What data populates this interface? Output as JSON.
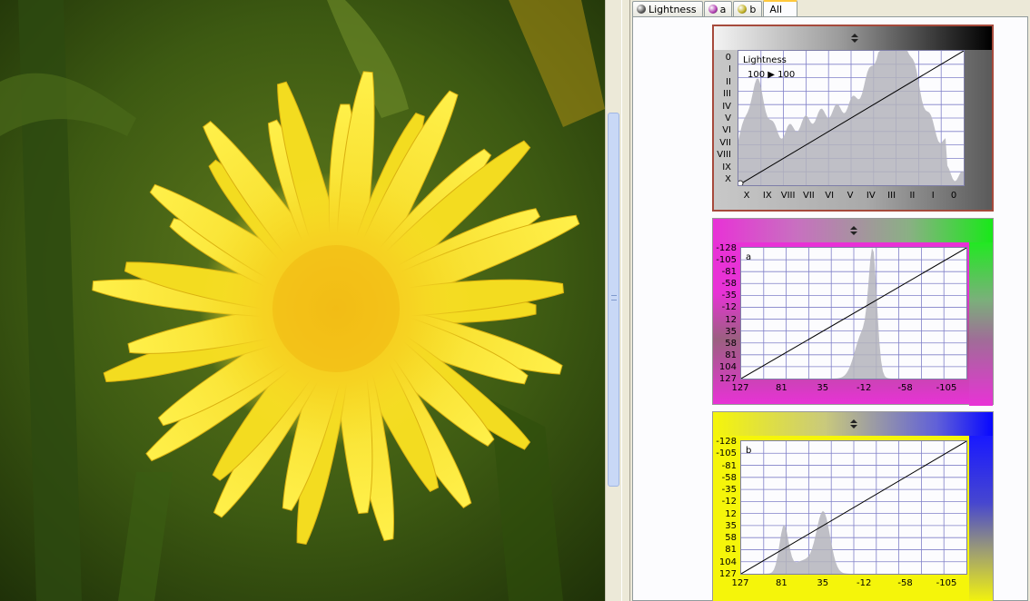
{
  "tabs": [
    {
      "label": "Lightness",
      "icon": "lightness-ball-icon",
      "color": "#555555"
    },
    {
      "label": "a",
      "icon": "a-ball-icon",
      "color": "#b03cb0"
    },
    {
      "label": "b",
      "icon": "b-ball-icon",
      "color": "#c0b020"
    },
    {
      "label": "All",
      "active": true
    }
  ],
  "lightness": {
    "name": "Lightness",
    "range": "100 ▶ 100",
    "y_ticks": [
      "0",
      "I",
      "II",
      "III",
      "IV",
      "V",
      "VI",
      "VII",
      "VIII",
      "IX",
      "X"
    ],
    "x_ticks": [
      "X",
      "IX",
      "VIII",
      "VII",
      "VI",
      "V",
      "IV",
      "III",
      "II",
      "I",
      "0"
    ],
    "colors": {
      "frame": "#a64a3c",
      "grid": "#8080c8",
      "hist": "#a9a9a9"
    }
  },
  "a_channel": {
    "name": "a",
    "y_ticks": [
      "-128",
      "-105",
      "-81",
      "-58",
      "-35",
      "-12",
      "12",
      "35",
      "58",
      "81",
      "104",
      "127"
    ],
    "x_ticks": [
      "127",
      "81",
      "35",
      "-12",
      "-58",
      "-105"
    ],
    "colors": {
      "left": "#e832d6",
      "right": "#19e819"
    }
  },
  "b_channel": {
    "name": "b",
    "y_ticks": [
      "-128",
      "-105",
      "-81",
      "-58",
      "-35",
      "-12",
      "12",
      "35",
      "58",
      "81",
      "104",
      "127"
    ],
    "x_ticks": [
      "127",
      "81",
      "35",
      "-12",
      "-58",
      "-105"
    ],
    "colors": {
      "left": "#f5f50a",
      "right": "#0808ff"
    }
  }
}
